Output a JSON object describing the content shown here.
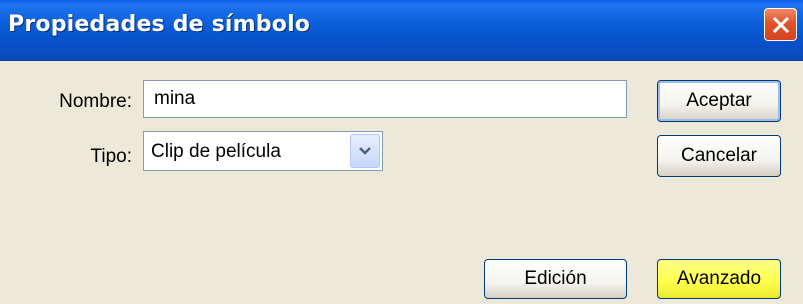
{
  "dialog": {
    "title": "Propiedades de símbolo",
    "close_icon": "close-icon"
  },
  "form": {
    "name_label": "Nombre:",
    "name_value": "mina",
    "type_label": "Tipo:",
    "type_value": "Clip de película"
  },
  "buttons": {
    "accept": "Aceptar",
    "cancel": "Cancelar",
    "edit": "Edición",
    "advanced": "Avanzado"
  },
  "colors": {
    "titlebar": "#0a56d8",
    "dialog_bg": "#ece9d8",
    "close_button": "#e0532d",
    "advanced_button": "#ffff4a"
  }
}
